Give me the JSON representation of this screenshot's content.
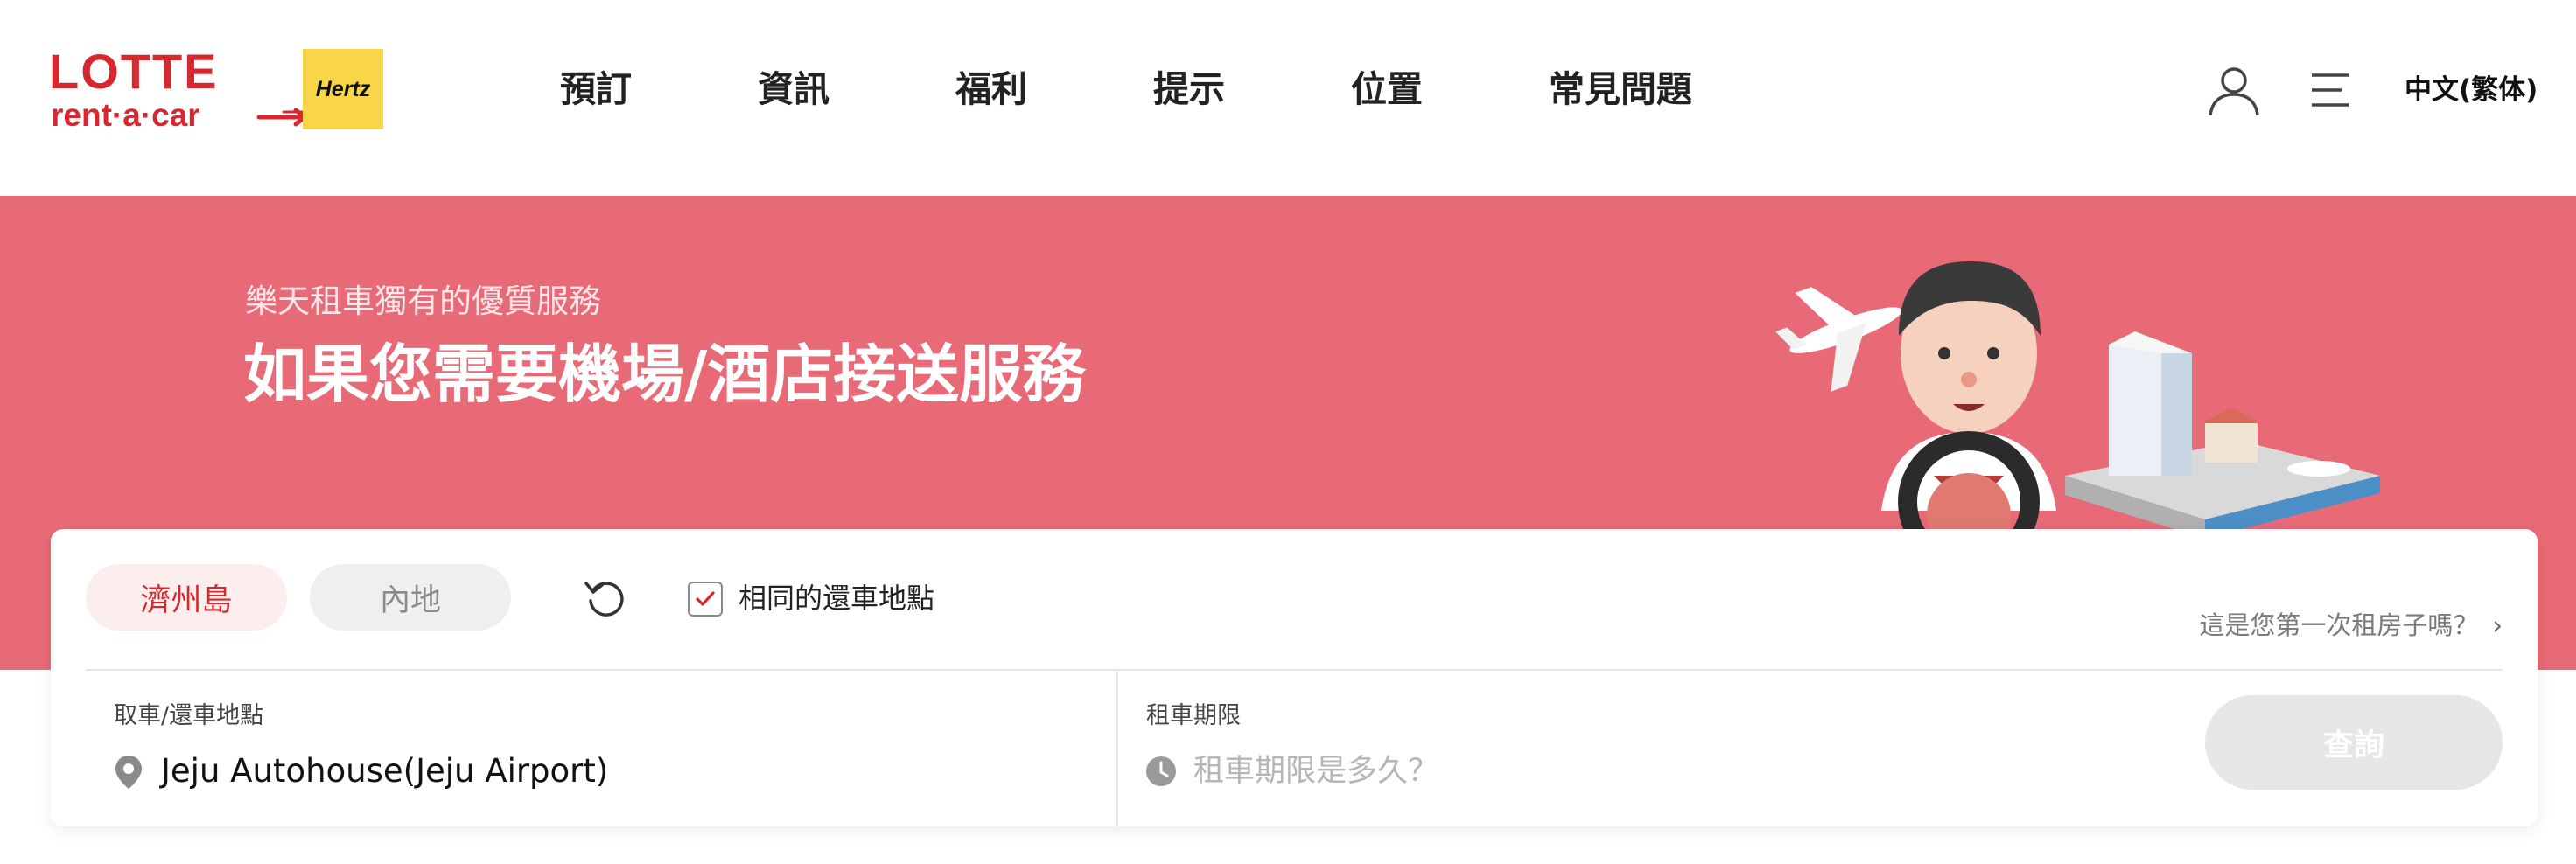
{
  "brand": {
    "name_line1": "LOTTE",
    "name_line2": "rent·a·car",
    "partner": "Hertz",
    "colors": {
      "primary": "#d7282f",
      "hertz_yellow": "#f9d648",
      "banner": "#e86a76"
    }
  },
  "nav": {
    "items": [
      {
        "label": "預訂"
      },
      {
        "label": "資訊"
      },
      {
        "label": "福利"
      },
      {
        "label": "提示"
      },
      {
        "label": "位置"
      },
      {
        "label": "常見問題"
      }
    ]
  },
  "header": {
    "user_icon": "user-icon",
    "menu_icon": "hamburger-menu-icon",
    "language": "中文(繁体)"
  },
  "banner": {
    "subtitle": "樂天租車獨有的優質服務",
    "title": "如果您需要機場/酒店接送服務"
  },
  "search": {
    "tabs": [
      {
        "label": "濟州島",
        "active": true
      },
      {
        "label": "內地",
        "active": false
      }
    ],
    "reset_icon": "reset-icon",
    "same_return_label": "相同的還車地點",
    "same_return_checked": true,
    "first_rental_link": "這是您第一次租房子嗎？",
    "location_label": "取車/還車地點",
    "location_value": "Jeju Autohouse(Jeju Airport)",
    "period_label": "租車期限",
    "period_placeholder": "租車期限是多久？",
    "search_button": "查詢"
  }
}
